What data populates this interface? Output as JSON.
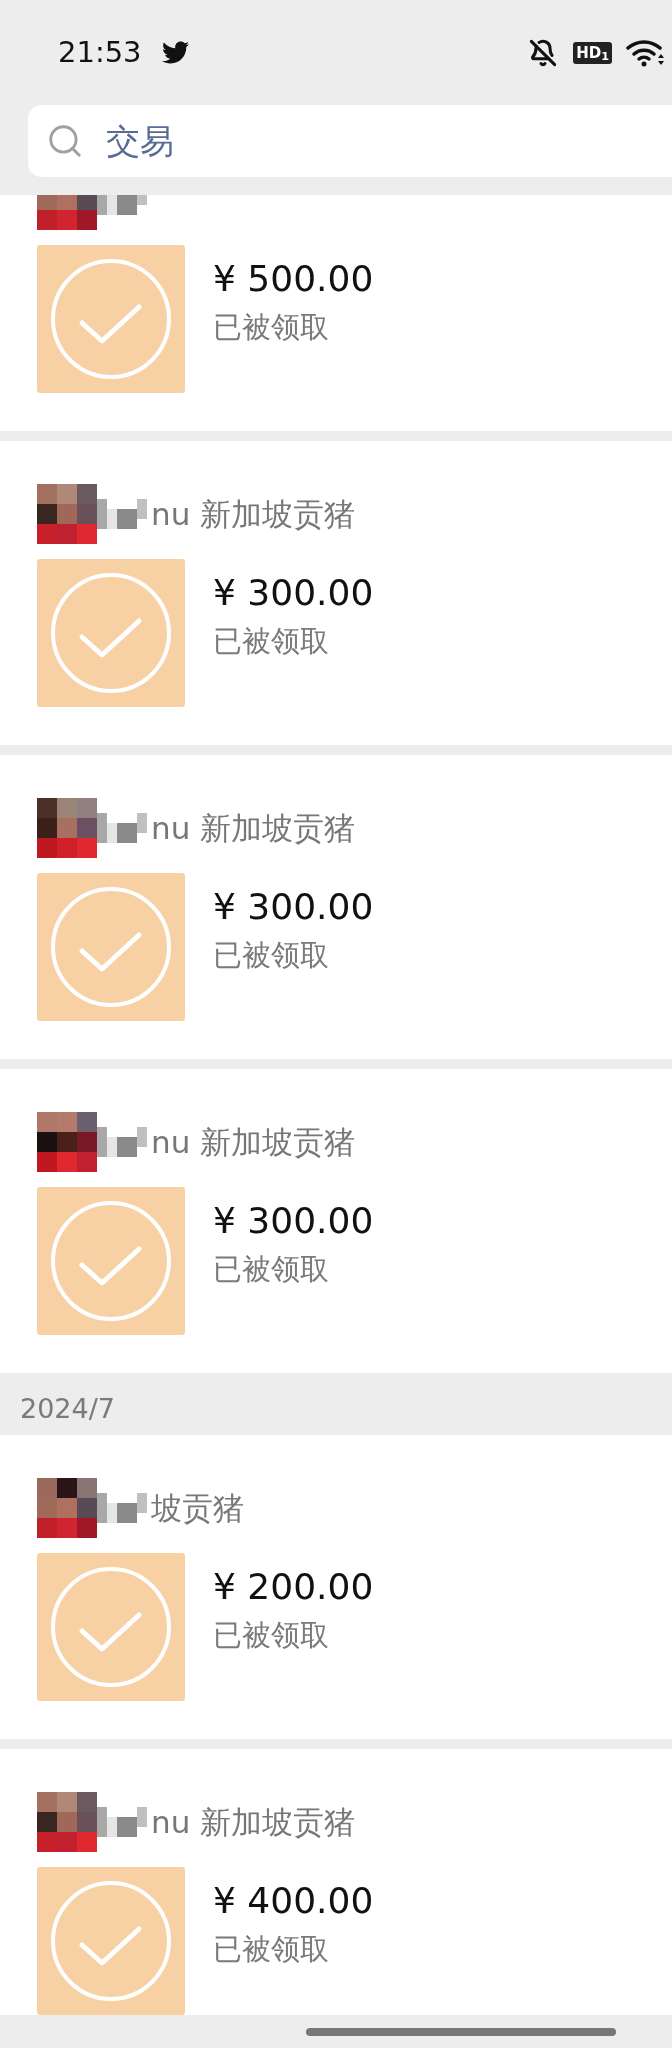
{
  "status_bar": {
    "time": "21:53",
    "hd_label": "HD$_{1}$"
  },
  "search": {
    "value": "交易"
  },
  "sections": [
    {
      "cards": [
        {
          "amount": "¥ 500.00",
          "status": "已被领取"
        },
        {
          "name": "nu 新加坡贡猪",
          "amount": "¥ 300.00",
          "status": "已被领取"
        },
        {
          "name": "nu 新加坡贡猪",
          "amount": "¥ 300.00",
          "status": "已被领取"
        },
        {
          "name": "nu 新加坡贡猪",
          "amount": "¥ 300.00",
          "status": "已被领取"
        }
      ]
    },
    {
      "date": "2024/7",
      "cards": [
        {
          "name": "坡贡猪",
          "amount": "¥ 200.00",
          "status": "已被领取"
        },
        {
          "name": "nu 新加坡贡猪",
          "amount": "¥ 400.00",
          "status": "已被领取"
        }
      ]
    }
  ]
}
